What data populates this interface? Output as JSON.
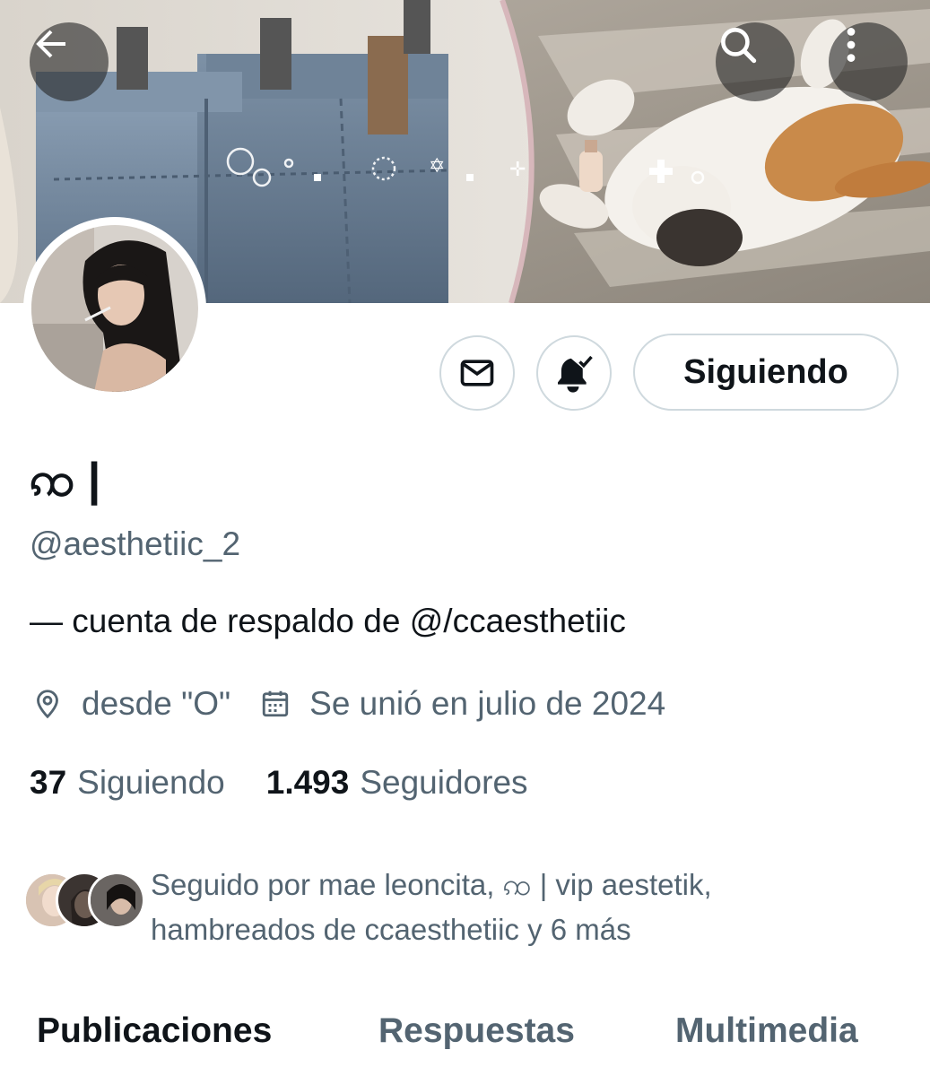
{
  "header": {
    "back_icon": "arrow-left-icon",
    "search_icon": "search-icon",
    "more_icon": "more-vertical-icon"
  },
  "actions": {
    "message_icon": "envelope-icon",
    "notifications_icon": "bell-check-icon",
    "follow_label": "Siguiendo"
  },
  "profile": {
    "display_name": "ꩡ |",
    "handle": "@aesthetiic_2",
    "bio": "— cuenta de respaldo de @/ccaesthetiic",
    "location": "desde \"O\"",
    "joined": "Se unió en julio de 2024"
  },
  "stats": {
    "following_count": "37",
    "following_label": "Siguiendo",
    "followers_count": "1.493",
    "followers_label": "Seguidores"
  },
  "followed_by": {
    "line1": "Seguido por mae leoncita, ꩡ | vip aestetik,",
    "line2": "hambreados de ccaesthetiic y 6 más"
  },
  "tabs": [
    {
      "label": "Publicaciones",
      "active": true
    },
    {
      "label": "Respuestas",
      "active": false
    },
    {
      "label": "Multimedia",
      "active": false
    }
  ],
  "colors": {
    "text_primary": "#0f1419",
    "text_secondary": "#536471",
    "border": "#cfd9de"
  }
}
